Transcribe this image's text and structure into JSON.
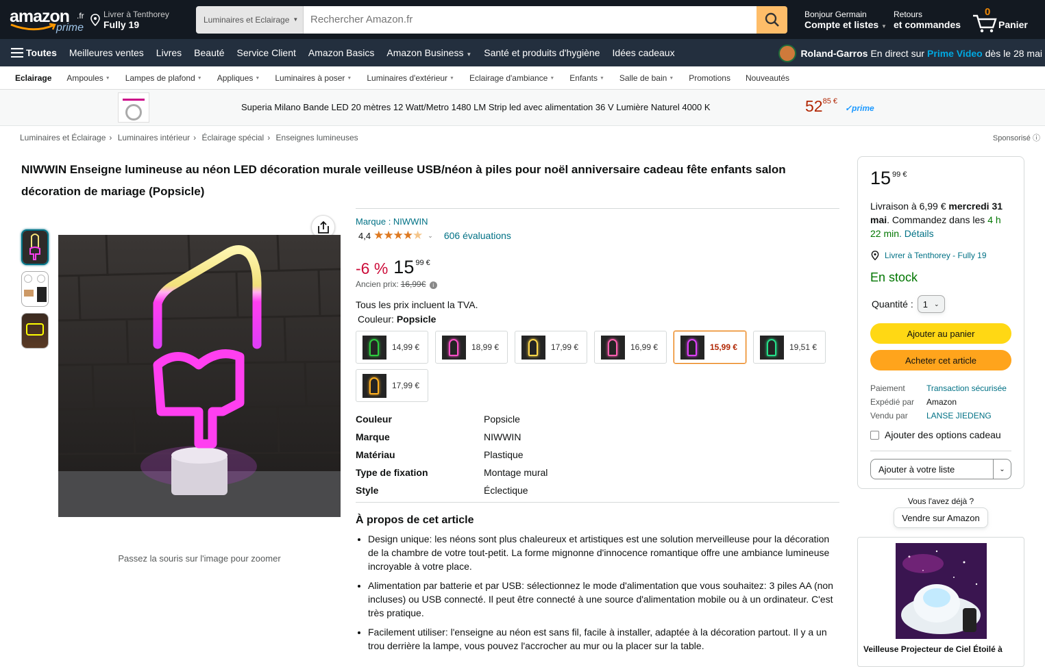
{
  "nav": {
    "logo_word": "amazon",
    "logo_tld": ".fr",
    "logo_prime": "prime",
    "deliver_line1": "Livrer à Tenthorey",
    "deliver_line2": "Fully 19",
    "search_category": "Luminaires et Eclairage",
    "search_placeholder": "Rechercher Amazon.fr",
    "account_line1": "Bonjour Germain",
    "account_line2": "Compte et listes",
    "returns_line1": "Retours",
    "returns_line2": "et commandes",
    "cart_count": "0",
    "cart_label": "Panier"
  },
  "main_nav": {
    "all": "Toutes",
    "items": [
      "Meilleures ventes",
      "Livres",
      "Beauté",
      "Service Client",
      "Amazon Basics",
      "Amazon Business",
      "Santé et produits d'hygiène",
      "Idées cadeaux"
    ],
    "promo_bold": "Roland-Garros",
    "promo_text": "En direct sur",
    "promo_link": "Prime Video",
    "promo_date": "dès le 28 mai"
  },
  "subnav": [
    "Eclairage",
    "Ampoules",
    "Lampes de plafond",
    "Appliques",
    "Luminaires à poser",
    "Luminaires d'extérieur",
    "Eclairage d'ambiance",
    "Enfants",
    "Salle de bain",
    "Promotions",
    "Nouveautés"
  ],
  "ad_banner": {
    "title": "Superia Milano Bande LED 20 mètres 12 Watt/Metro 1480 LM Strip led avec alimentation 36 V Lumière Naturel 4000 K",
    "price_whole": "52",
    "price_cents": "85 €",
    "prime": "✓prime"
  },
  "breadcrumb": [
    "Luminaires et Éclairage",
    "Luminaires intérieur",
    "Éclairage spécial",
    "Enseignes lumineuses"
  ],
  "sponsored": "Sponsorisé",
  "product": {
    "title": "NIWWIN Enseigne lumineuse au néon LED décoration murale veilleuse USB/néon à piles pour noël anniversaire cadeau fête enfants salon décoration de mariage (Popsicle)",
    "zoom_hint": "Passez la souris sur l'image pour zoomer",
    "brand": "Marque : NIWWIN",
    "rating_value": "4,4",
    "rating_stars": 4.4,
    "rating_count": "606 évaluations",
    "discount": "-6 %",
    "price_whole": "15",
    "price_cents": "99 €",
    "old_price_label": "Ancien prix:",
    "old_price": "16,99€",
    "tva": "Tous les prix incluent la TVA.",
    "color_label": "Couleur:",
    "color_value": "Popsicle",
    "swatches": [
      {
        "price": "14,99 €",
        "color": "#2ecc40"
      },
      {
        "price": "18,99 €",
        "color": "#ff4fc8"
      },
      {
        "price": "17,99 €",
        "color": "#ffd84a"
      },
      {
        "price": "16,99 €",
        "color": "#ff5fb0"
      },
      {
        "price": "15,99 €",
        "color": "#e040fb"
      },
      {
        "price": "19,51 €",
        "color": "#25e08a"
      },
      {
        "price": "17,99 €",
        "color": "#ffb020"
      }
    ],
    "specs": [
      {
        "k": "Couleur",
        "v": "Popsicle"
      },
      {
        "k": "Marque",
        "v": "NIWWIN"
      },
      {
        "k": "Matériau",
        "v": "Plastique"
      },
      {
        "k": "Type de fixation",
        "v": "Montage mural"
      },
      {
        "k": "Style",
        "v": "Éclectique"
      }
    ],
    "about_title": "À propos de cet article",
    "about": [
      "Design unique: les néons sont plus chaleureux et artistiques est une solution merveilleuse pour la décoration de la chambre de votre tout-petit. La forme mignonne d'innocence romantique offre une ambiance lumineuse incroyable à votre place.",
      "Alimentation par batterie et par USB: sélectionnez le mode d'alimentation que vous souhaitez: 3 piles AA (non incluses) ou USB connecté. Il peut être connecté à une source d'alimentation mobile ou à un ordinateur. C'est très pratique.",
      "Facilement utiliser: l'enseigne au néon est sans fil, facile à installer, adaptée à la décoration partout. Il y a un trou derrière la lampe, vous pouvez l'accrocher au mur ou la placer sur la table."
    ]
  },
  "buybox": {
    "price_whole": "15",
    "price_cents": "99 €",
    "delivery_prefix": "Livraison à 6,99 € ",
    "delivery_date": "mercredi 31 mai",
    "delivery_mid": ". Commandez dans les ",
    "delivery_time": "4 h 22 min",
    "delivery_details": ". Détails",
    "location": "Livrer à Tenthorey - Fully 19",
    "stock": "En stock",
    "qty_label": "Quantité :",
    "qty_value": "1",
    "add_to_cart": "Ajouter au panier",
    "buy_now": "Acheter cet article",
    "info": [
      {
        "k": "Paiement",
        "v": "Transaction sécurisée",
        "link": true
      },
      {
        "k": "Expédié par",
        "v": "Amazon",
        "link": false
      },
      {
        "k": "Vendu par",
        "v": "LANSE JIEDENG",
        "link": true
      }
    ],
    "gift": "Ajouter des options cadeau",
    "list": "Ajouter à votre liste"
  },
  "sell": {
    "question": "Vous l'avez déjà ?",
    "button": "Vendre sur Amazon"
  },
  "ad_card": {
    "caption": "Veilleuse Projecteur de Ciel Étoilé à"
  }
}
